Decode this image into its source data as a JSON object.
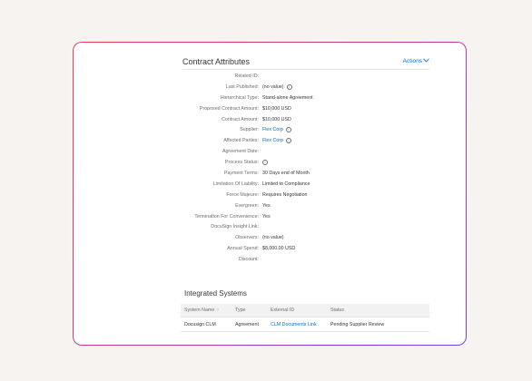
{
  "section": {
    "title": "Contract Attributes",
    "actions_label": "Actions"
  },
  "attributes": [
    {
      "label": "Related ID:",
      "value": "",
      "info": false,
      "link": false
    },
    {
      "label": "Last Published:",
      "value": "(no value)",
      "info": true,
      "link": false
    },
    {
      "label": "Hierarchical Type:",
      "value": "Stand-alone Agreement",
      "info": false,
      "link": false
    },
    {
      "label": "Proposed Contract Amount:",
      "value": "$10,000 USD",
      "info": false,
      "link": false
    },
    {
      "label": "Contract Amount:",
      "value": "$10,000 USD",
      "info": false,
      "link": false
    },
    {
      "label": "Supplier:",
      "value": "Flex Corp",
      "info": true,
      "link": true
    },
    {
      "label": "Affected Parties:",
      "value": "Flex Corp",
      "info": true,
      "link": true
    },
    {
      "label": "Agreement Date:",
      "value": "",
      "info": false,
      "link": false
    },
    {
      "label": "Process Status:",
      "value": "",
      "info": true,
      "link": false
    },
    {
      "label": "Payment Terms:",
      "value": "30 Days end of Month",
      "info": false,
      "link": false
    },
    {
      "label": "Limitation Of Liability:",
      "value": "Limited to Compliance",
      "info": false,
      "link": false
    },
    {
      "label": "Force Majeure:",
      "value": "Requires Negotiation",
      "info": false,
      "link": false
    },
    {
      "label": "Evergreen:",
      "value": "Yes",
      "info": false,
      "link": false
    },
    {
      "label": "Termination For Convenience:",
      "value": "Yes",
      "info": false,
      "link": false
    },
    {
      "label": "DocuSign Insight Link:",
      "value": "",
      "info": false,
      "link": false
    },
    {
      "label": "Observers:",
      "value": "(no value)",
      "info": false,
      "link": false
    },
    {
      "label": "Annual Spend:",
      "value": "$8,000.00 USD",
      "info": false,
      "link": false
    },
    {
      "label": "Discount:",
      "value": "",
      "info": false,
      "link": false
    }
  ],
  "integrated": {
    "title": "Integrated Systems",
    "columns": [
      "System Name",
      "Type",
      "External ID",
      "Status"
    ],
    "sort_indicator": "↑",
    "rows": [
      {
        "system_name": "Docusign CLM",
        "type": "Agreement",
        "external_id": "CLM Documents Link",
        "status": "Pending Supplier Review"
      }
    ]
  },
  "colors": {
    "accent": "#0a6ed1",
    "border_gradient_start": "#ef3b4f",
    "border_gradient_end": "#6b3df0",
    "background": "#f7f3f1"
  },
  "icons": {
    "info": "info-circle-icon",
    "actions_chevron": "chevron-down-icon",
    "sort": "sort-ascending-icon"
  }
}
